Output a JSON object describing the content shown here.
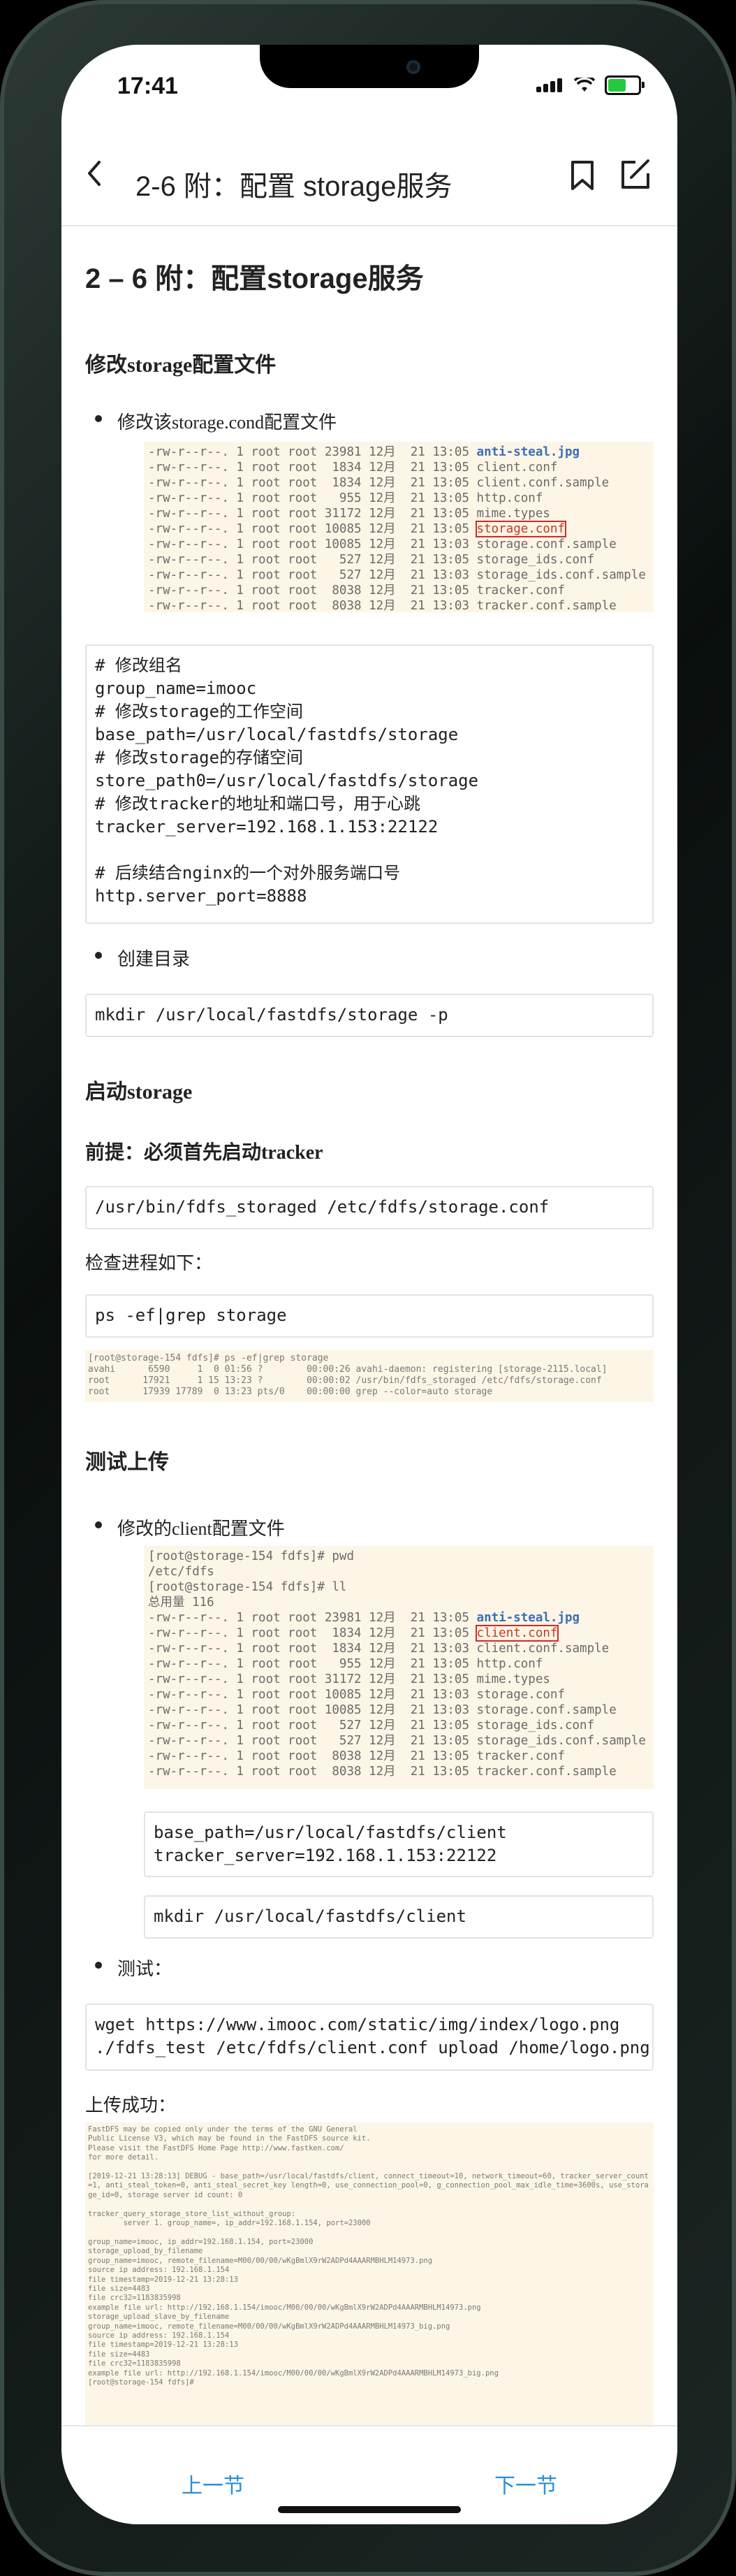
{
  "status": {
    "time": "17:41"
  },
  "nav": {
    "title": "2-6 附：配置 storage服务"
  },
  "page": {
    "h1": "2 – 6 附：配置storage服务",
    "s1_title": "修改storage配置文件",
    "s1_bullet": "修改该storage.cond配置文件",
    "term1": [
      "-rw-r--r--. 1 root root 23981 12月  21 13:05 ",
      "-rw-r--r--. 1 root root  1834 12月  21 13:05 client.conf",
      "-rw-r--r--. 1 root root  1834 12月  21 13:05 client.conf.sample",
      "-rw-r--r--. 1 root root   955 12月  21 13:05 http.conf",
      "-rw-r--r--. 1 root root 31172 12月  21 13:05 mime.types",
      "-rw-r--r--. 1 root root 10085 12月  21 13:05 ",
      "-rw-r--r--. 1 root root 10085 12月  21 13:03 storage.conf.sample",
      "-rw-r--r--. 1 root root   527 12月  21 13:05 storage_ids.conf",
      "-rw-r--r--. 1 root root   527 12月  21 13:03 storage_ids.conf.sample",
      "-rw-r--r--. 1 root root  8038 12月  21 13:05 tracker.conf",
      "-rw-r--r--. 1 root root  8038 12月  21 13:03 tracker.conf.sample"
    ],
    "term1_hl": "anti-steal.jpg",
    "term1_box": "storage.conf",
    "code1": "# 修改组名\ngroup_name=imooc\n# 修改storage的工作空间\nbase_path=/usr/local/fastdfs/storage\n# 修改storage的存储空间\nstore_path0=/usr/local/fastdfs/storage\n# 修改tracker的地址和端口号，用于心跳\ntracker_server=192.168.1.153:22122\n\n# 后续结合nginx的一个对外服务端口号\nhttp.server_port=8888",
    "bullet2": "创建目录",
    "code2": "mkdir /usr/local/fastdfs/storage -p",
    "s2_title": "启动storage",
    "s2_sub": "前提：必须首先启动tracker",
    "code3": "/usr/bin/fdfs_storaged /etc/fdfs/storage.conf",
    "check_text": "检查进程如下：",
    "code4": "ps -ef|grep storage",
    "term2": "[root@storage-154 fdfs]# ps -ef|grep storage\navahi      6590     1  0 01:56 ?        00:00:26 avahi-daemon: registering [storage-2115.local]\nroot      17921     1 15 13:23 ?        00:00:02 /usr/bin/fdfs_storaged /etc/fdfs/storage.conf\nroot      17939 17789  0 13:23 pts/0    00:00:00 grep --color=auto storage",
    "s3_title": "测试上传",
    "s3_bullet": "修改的client配置文件",
    "term3_head": "[root@storage-154 fdfs]# pwd\n/etc/fdfs\n[root@storage-154 fdfs]# ll\n总用量 116",
    "term3": [
      "-rw-r--r--. 1 root root 23981 12月  21 13:05 ",
      "-rw-r--r--. 1 root root  1834 12月  21 13:05 ",
      "-rw-r--r--. 1 root root  1834 12月  21 13:03 client.conf.sample",
      "-rw-r--r--. 1 root root   955 12月  21 13:05 http.conf",
      "-rw-r--r--. 1 root root 31172 12月  21 13:05 mime.types",
      "-rw-r--r--. 1 root root 10085 12月  21 13:03 storage.conf",
      "-rw-r--r--. 1 root root 10085 12月  21 13:03 storage.conf.sample",
      "-rw-r--r--. 1 root root   527 12月  21 13:05 storage_ids.conf",
      "-rw-r--r--. 1 root root   527 12月  21 13:05 storage_ids.conf.sample",
      "-rw-r--r--. 1 root root  8038 12月  21 13:05 tracker.conf",
      "-rw-r--r--. 1 root root  8038 12月  21 13:05 tracker.conf.sample"
    ],
    "term3_hl": "anti-steal.jpg",
    "term3_box": "client.conf",
    "code5": "base_path=/usr/local/fastdfs/client\ntracker_server=192.168.1.153:22122",
    "code6": "mkdir /usr/local/fastdfs/client",
    "bullet_test": "测试：",
    "code7": "wget https://www.imooc.com/static/img/index/logo.png\n./fdfs_test /etc/fdfs/client.conf upload /home/logo.png",
    "success_text": "上传成功：",
    "term4": "FastDFS may be copied only under the terms of the GNU General\nPublic License V3, which may be found in the FastDFS source kit.\nPlease visit the FastDFS Home Page http://www.fastken.com/\nfor more detail.\n\n[2019-12-21 13:28:13] DEBUG - base_path=/usr/local/fastdfs/client, connect_timeout=10, network_timeout=60, tracker_server_count=1, anti_steal_token=0, anti_steal_secret_key length=0, use_connection_pool=0, g_connection_pool_max_idle_time=3600s, use_storage_id=0, storage server id count: 0\n\ntracker_query_storage_store_list_without_group:\n        server 1. group_name=, ip_addr=192.168.1.154, port=23000\n\ngroup_name=imooc, ip_addr=192.168.1.154, port=23000\nstorage_upload_by_filename\ngroup_name=imooc, remote_filename=M00/00/00/wKgBmlX9rW2ADPd4AAARMBHLM14973.png\nsource ip address: 192.168.1.154\nfile timestamp=2019-12-21 13:28:13\nfile size=4483\nfile crc32=1183835998\nexample file url: http://192.168.1.154/imooc/M00/00/00/wKgBmlX9rW2ADPd4AAARMBHLM14973.png\nstorage_upload_slave_by_filename\ngroup_name=imooc, remote_filename=M00/00/00/wKgBmlX9rW2ADPd4AAARMBHLM14973_big.png\nsource ip address: 192.168.1.154\nfile timestamp=2019-12-21 13:28:13\nfile size=4483\nfile crc32=1183835998\nexample file url: http://192.168.1.154/imooc/M00/00/00/wKgBmlX9rW2ADPd4AAARMBHLM14973_big.png\n[root@storage-154 fdfs]#"
  },
  "bottom": {
    "prev": "上一节",
    "next": "下一节"
  }
}
